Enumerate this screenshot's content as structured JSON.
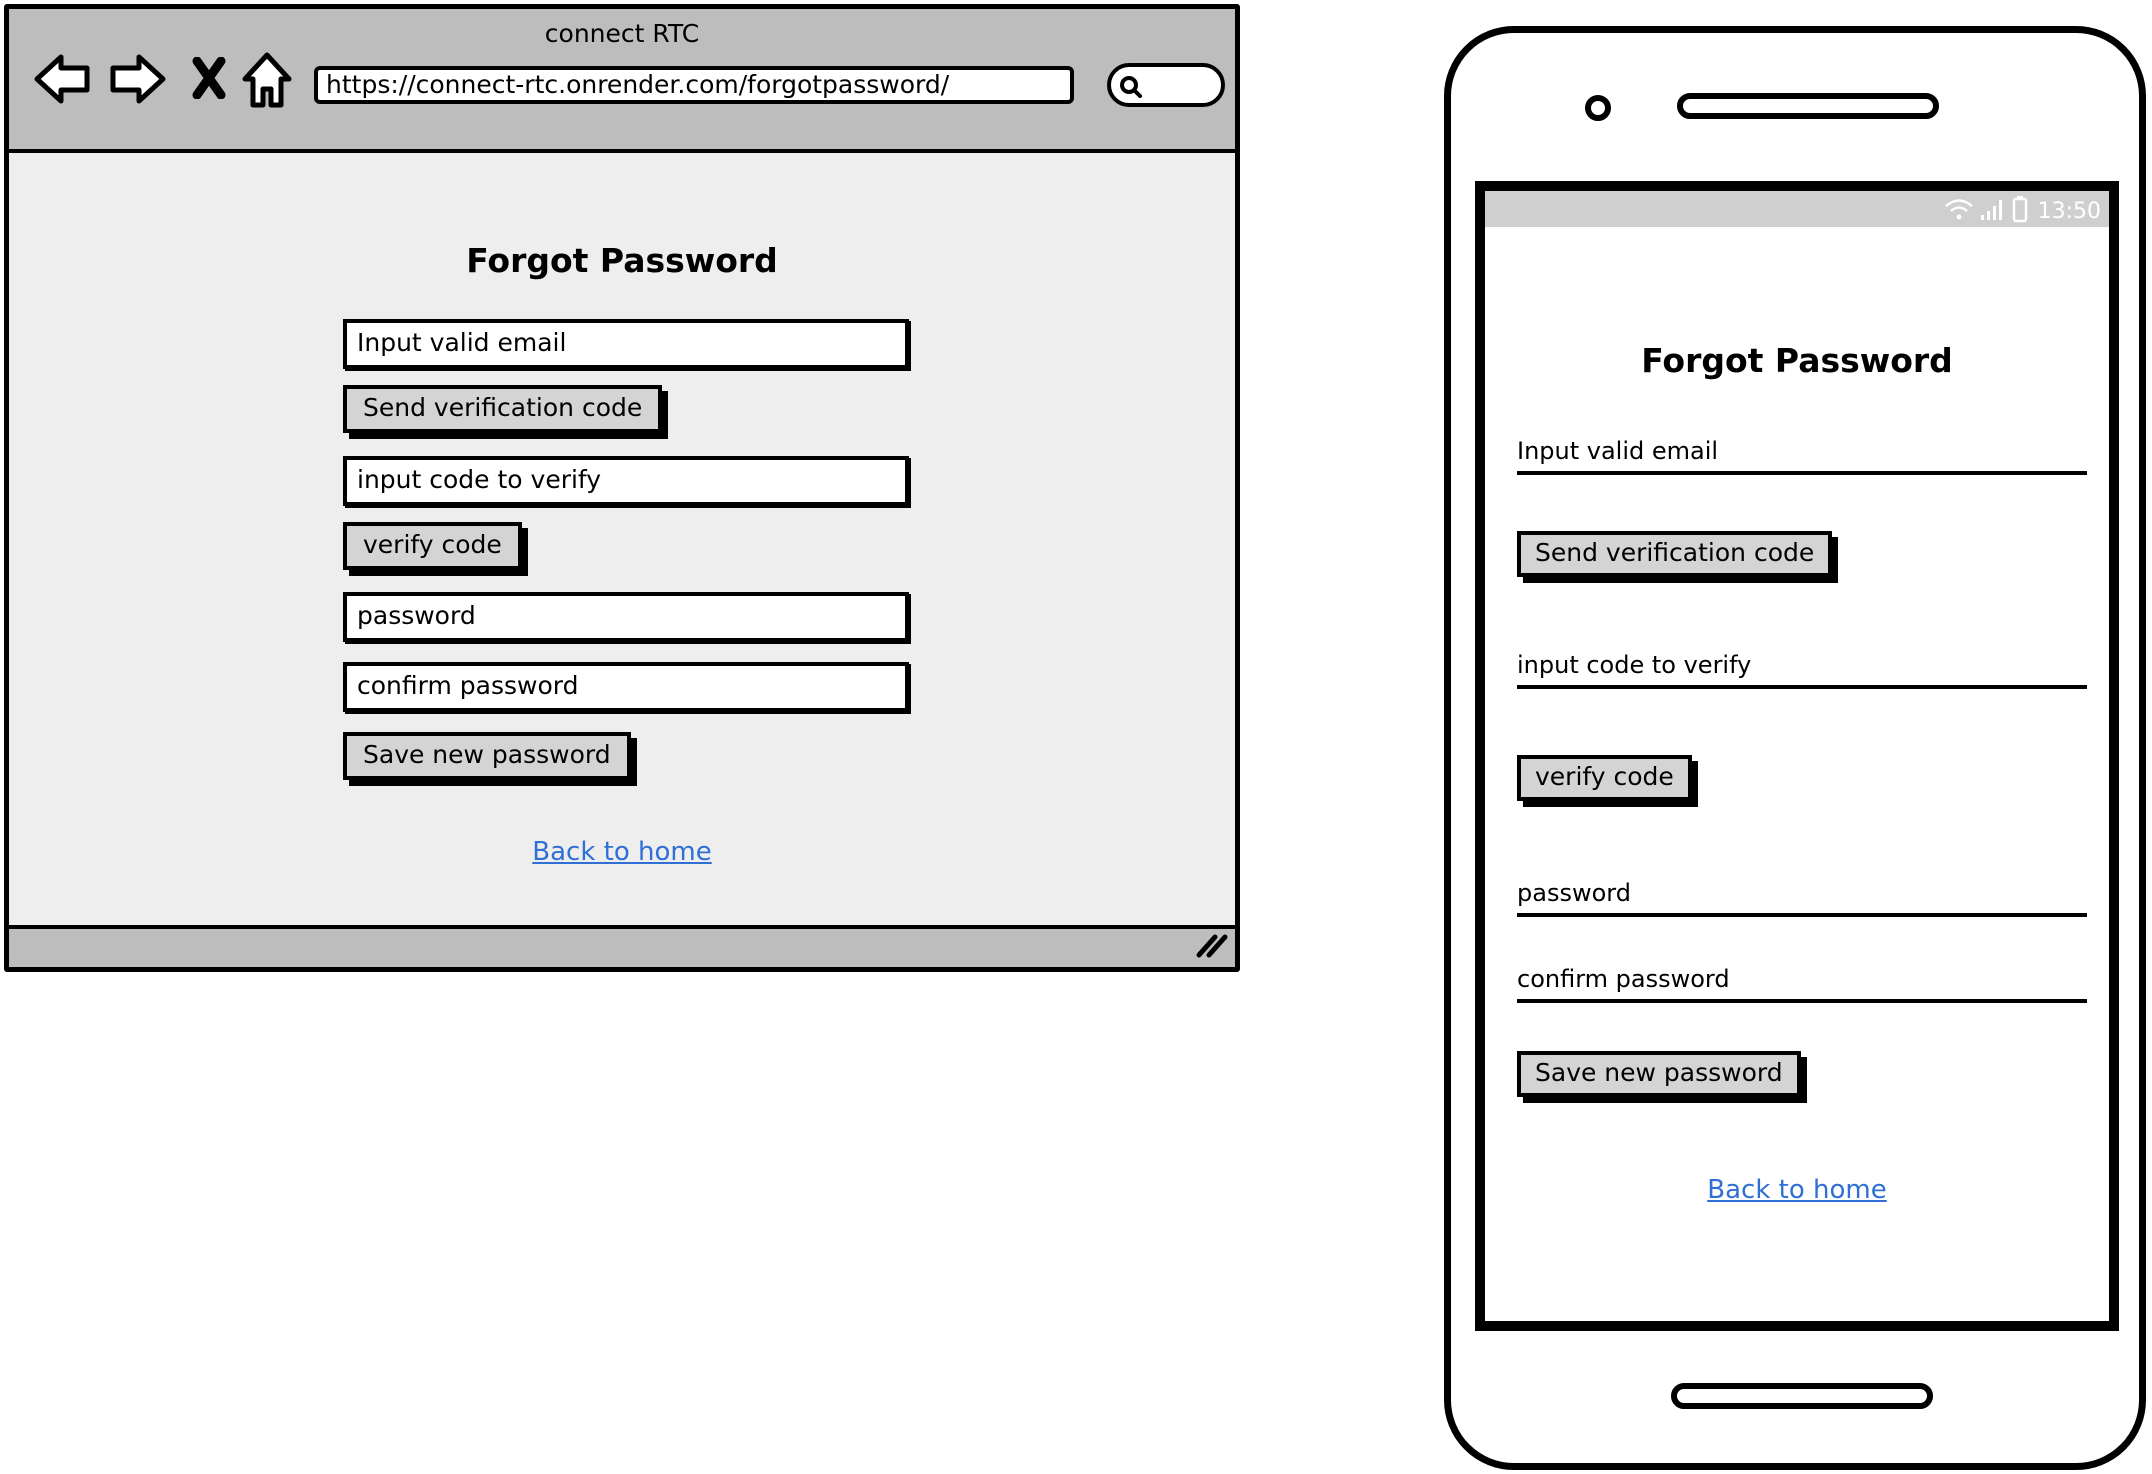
{
  "browser": {
    "title": "connect RTC",
    "url": "https://connect-rtc.onrender.com/forgotpassword/"
  },
  "form": {
    "heading": "Forgot Password",
    "email_placeholder": "Input valid email",
    "send_code_label": "Send verification code",
    "code_placeholder": "input code to verify",
    "verify_label": "verify code",
    "password_placeholder": "password",
    "confirm_placeholder": "confirm password",
    "save_label": "Save new password",
    "back_link": "Back to home"
  },
  "phone": {
    "time": "13:50"
  },
  "colors": {
    "link": "#2f6fd6",
    "chrome": "#bdbdbd",
    "content_bg": "#eeeeee",
    "button_bg": "#d4d4d4"
  }
}
